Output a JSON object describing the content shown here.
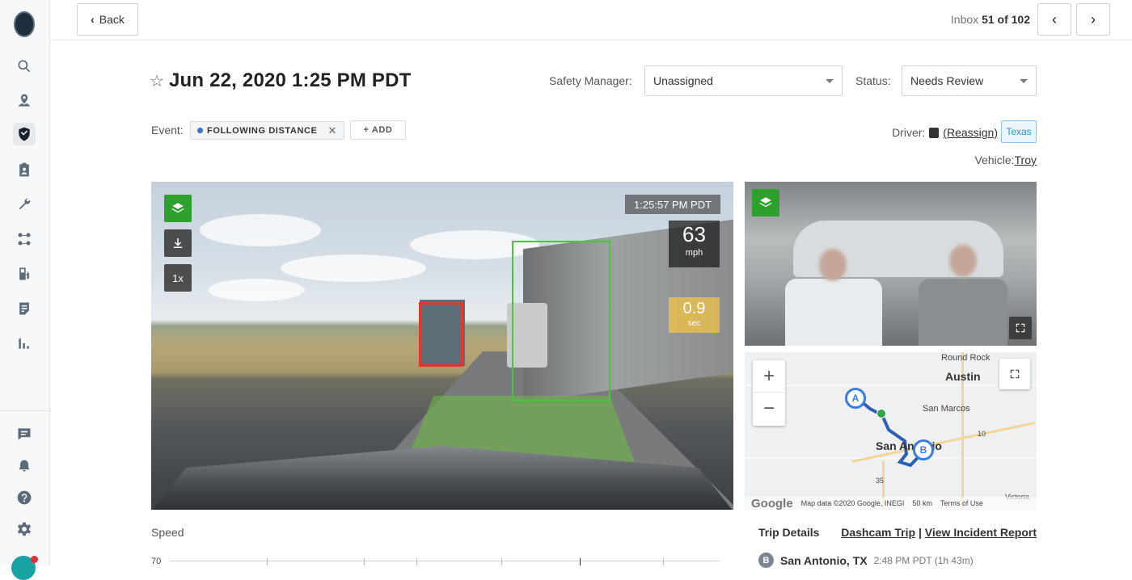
{
  "topbar": {
    "back_label": "Back",
    "inbox_prefix": "Inbox",
    "inbox_position": "51 of 102",
    "prev_icon": "chevron-left-icon",
    "next_icon": "chevron-right-icon"
  },
  "sidebar": {
    "items": [
      {
        "name": "search",
        "icon": "search-icon"
      },
      {
        "name": "map",
        "icon": "map-pin-icon"
      },
      {
        "name": "safety",
        "icon": "shield-icon",
        "active": true
      },
      {
        "name": "compliance",
        "icon": "clipboard-icon"
      },
      {
        "name": "maintenance",
        "icon": "wrench-icon"
      },
      {
        "name": "dispatch",
        "icon": "route-icon"
      },
      {
        "name": "fuel",
        "icon": "fuel-icon"
      },
      {
        "name": "documents",
        "icon": "document-icon"
      },
      {
        "name": "reports",
        "icon": "bar-chart-icon"
      }
    ],
    "bottom_items": [
      {
        "name": "messages",
        "icon": "chat-icon"
      },
      {
        "name": "alerts",
        "icon": "bell-icon"
      },
      {
        "name": "help",
        "icon": "help-icon"
      },
      {
        "name": "settings",
        "icon": "gear-icon"
      }
    ]
  },
  "header": {
    "title": "Jun 22, 2020 1:25 PM PDT",
    "safety_manager_label": "Safety Manager:",
    "safety_manager_value": "Unassigned",
    "status_label": "Status:",
    "status_value": "Needs Review"
  },
  "event": {
    "label": "Event:",
    "tag": "FOLLOWING DISTANCE",
    "tag_color": "#3b73c7",
    "add_label": "+ ADD"
  },
  "driver": {
    "label": "Driver:",
    "reassign_link": "(Reassign)",
    "tag": "Texas",
    "vehicle_label": "Vehicle:",
    "vehicle_value": "Troy"
  },
  "video": {
    "timestamp": "1:25:57 PM PDT",
    "speed_value": "63",
    "speed_unit": "mph",
    "gap_value": "0.9",
    "gap_unit": "sec",
    "playback_speed": "1x",
    "accent_green": "#2ea02e",
    "box_lead_color": "#e0382b",
    "box_side_color": "#4cc33b"
  },
  "map": {
    "cities": {
      "austin": "Austin",
      "round_rock": "Round Rock",
      "san_marcos": "San Marcos",
      "san_antonio": "San Antonio",
      "victoria": "Victoria"
    },
    "highway_10": "10",
    "highway_35": "35",
    "marker_a": "A",
    "marker_b": "B",
    "attribution": "Map data ©2020 Google, INEGI",
    "scale": "50 km",
    "terms": "Terms of Use",
    "google": "Google",
    "zoom_in": "+",
    "zoom_out": "−"
  },
  "bottom": {
    "speed_label": "Speed",
    "axis_top": "70",
    "trip_details": "Trip Details",
    "dashcam_trip": "Dashcam Trip",
    "separator": "|",
    "incident_report": "View Incident Report",
    "stop_badge": "B",
    "stop_city": "San Antonio, TX",
    "stop_meta": "2:48 PM PDT (1h 43m)"
  }
}
